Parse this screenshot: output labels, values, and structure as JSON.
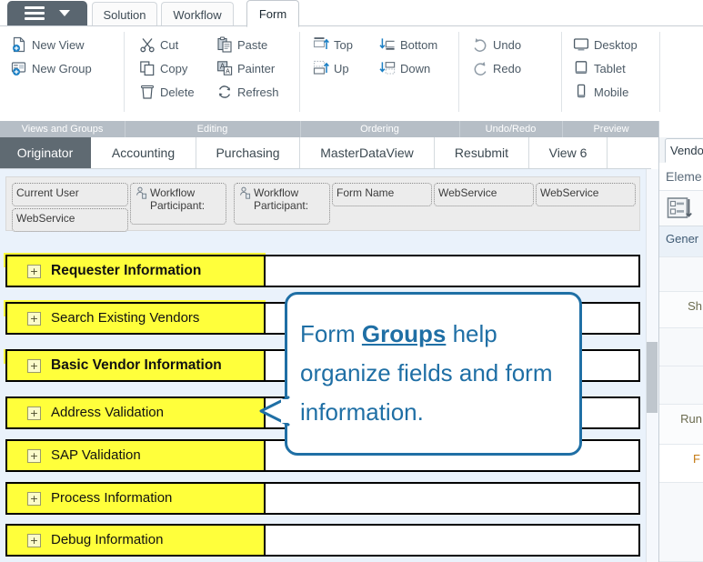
{
  "window": {
    "menu_button": "menu-button"
  },
  "ribbon": {
    "tabs": [
      {
        "label": "Solution",
        "active": false
      },
      {
        "label": "Workflow",
        "active": false
      },
      {
        "label": "Form",
        "active": true
      }
    ],
    "groups": [
      {
        "name": "Views and Groups",
        "label": "Views and Groups",
        "commands": [
          {
            "label": "New View",
            "icon": "new-view-icon"
          },
          {
            "label": "New Group",
            "icon": "new-group-icon"
          }
        ]
      },
      {
        "name": "Editing",
        "label": "Editing",
        "commands": [
          {
            "label": "Cut",
            "icon": "scissors-icon"
          },
          {
            "label": "Copy",
            "icon": "copy-icon"
          },
          {
            "label": "Delete",
            "icon": "trash-icon"
          },
          {
            "label": "Paste",
            "icon": "clipboard-icon"
          },
          {
            "label": "Painter",
            "icon": "format-painter-icon"
          },
          {
            "label": "Refresh",
            "icon": "refresh-icon"
          }
        ]
      },
      {
        "name": "Ordering",
        "label": "Ordering",
        "commands": [
          {
            "label": "Top",
            "icon": "move-top-icon"
          },
          {
            "label": "Up",
            "icon": "move-up-icon"
          },
          {
            "label": "Bottom",
            "icon": "move-bottom-icon"
          },
          {
            "label": "Down",
            "icon": "move-down-icon"
          }
        ]
      },
      {
        "name": "Undo/Redo",
        "label": "Undo/Redo",
        "commands": [
          {
            "label": "Undo",
            "icon": "undo-arrow-icon"
          },
          {
            "label": "Redo",
            "icon": "redo-arrow-icon"
          }
        ]
      },
      {
        "name": "Preview",
        "label": "Preview",
        "commands": [
          {
            "label": "Desktop",
            "icon": "monitor-icon"
          },
          {
            "label": "Tablet",
            "icon": "tablet-icon"
          },
          {
            "label": "Mobile",
            "icon": "phone-icon"
          }
        ]
      }
    ]
  },
  "view_tabs": [
    {
      "label": "Originator",
      "active": true
    },
    {
      "label": "Accounting",
      "active": false
    },
    {
      "label": "Purchasing",
      "active": false
    },
    {
      "label": "MasterDataView",
      "active": false
    },
    {
      "label": "Resubmit",
      "active": false
    },
    {
      "label": "View 6",
      "active": false
    },
    {
      "label": "",
      "active": false
    }
  ],
  "form_canvas": {
    "field_chips": [
      {
        "label": "Current User",
        "icon": null
      },
      {
        "label": "Workflow Participant:",
        "icon": "workflow-participant-icon"
      },
      {
        "label": "Workflow Participant:",
        "icon": "workflow-participant-icon"
      },
      {
        "label": "Form Name",
        "icon": null
      },
      {
        "label": "WebService",
        "icon": null
      },
      {
        "label": "WebService",
        "icon": null
      },
      {
        "label": "WebService",
        "icon": null
      }
    ],
    "groups": [
      {
        "label": "Requester Information",
        "bold": true,
        "expander": "+"
      },
      {
        "label": "Search Existing Vendors",
        "bold": false,
        "expander": "+"
      },
      {
        "label": "Basic Vendor Information",
        "bold": true,
        "expander": "+"
      },
      {
        "label": "Address Validation",
        "bold": false,
        "expander": "+"
      },
      {
        "label": "SAP Validation",
        "bold": false,
        "expander": "+"
      },
      {
        "label": "Process Information",
        "bold": false,
        "expander": "+"
      },
      {
        "label": "Debug Information",
        "bold": false,
        "expander": "+"
      }
    ],
    "highlight_color": "#ffff3b"
  },
  "callout": {
    "text_before": "Form ",
    "text_emphasis": "Groups",
    "text_after": " help organize fields and form information.",
    "border_color": "#1f6fa5",
    "text_color": "#1f6fa5"
  },
  "right_panel": {
    "tab_label": "Vendo",
    "header": "Eleme",
    "toolbar_icon": "sort-properties-icon",
    "rows": [
      {
        "type": "cat",
        "text": "Gener"
      },
      {
        "type": "blank",
        "text": ""
      },
      {
        "type": "lbl",
        "text": "Sh"
      },
      {
        "type": "blank",
        "text": ""
      },
      {
        "type": "blank",
        "text": ""
      },
      {
        "type": "lbl",
        "text": "Run"
      },
      {
        "type": "val",
        "text": "F"
      },
      {
        "type": "blank",
        "text": ""
      }
    ]
  },
  "scrollbar": {
    "name": "canvas-vertical-scrollbar"
  }
}
